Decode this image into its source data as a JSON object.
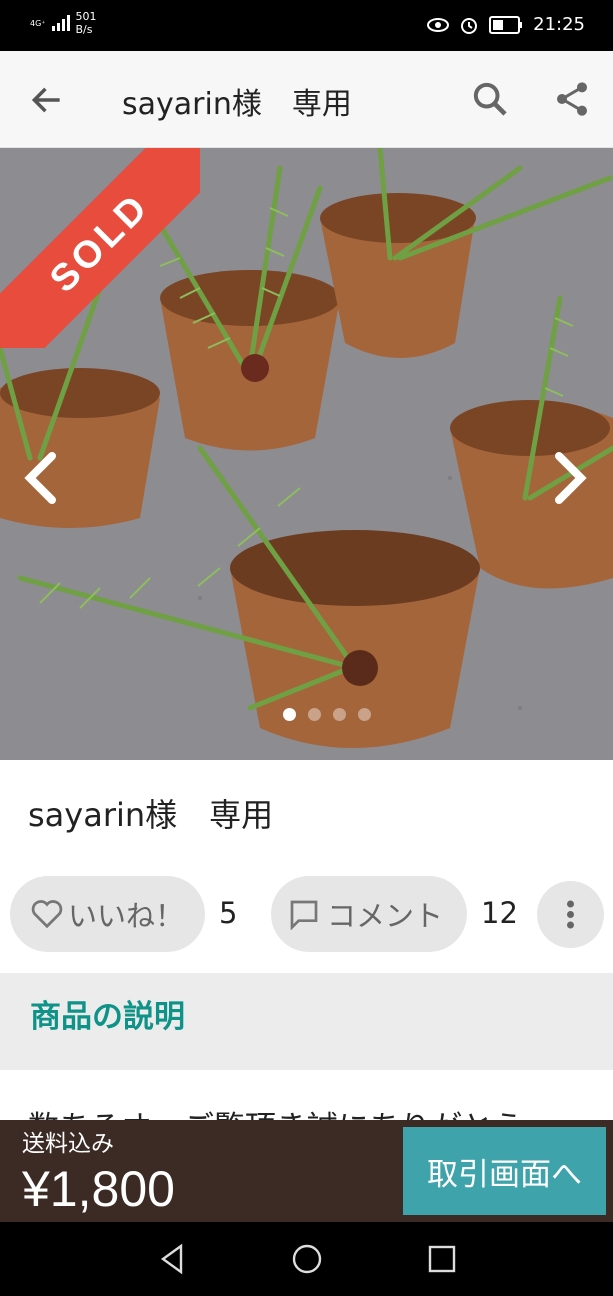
{
  "status_bar": {
    "network": "4G⁺",
    "speed_value": "501",
    "speed_unit": "B/s",
    "time": "21:25"
  },
  "app_bar": {
    "title": "sayarin様　専用"
  },
  "hero": {
    "badge": "SOLD",
    "page_count": 4,
    "active_page": 1
  },
  "item": {
    "title": "sayarin様　専用"
  },
  "actions": {
    "like_label": "いいね！",
    "like_count": "5",
    "comment_label": "コメント",
    "comment_count": "12"
  },
  "description": {
    "heading": "商品の説明",
    "text_partial": "数あるオ…ご覧頂き誠にありがとう"
  },
  "bottom_bar": {
    "shipping_label": "送料込み",
    "price": "¥1,800",
    "cta_label": "取引画面へ"
  },
  "colors": {
    "accent": "#0f9287",
    "sold_red": "#e74c3c",
    "cta_teal": "#3fa3ab",
    "bottom_brown": "#3b2b24"
  }
}
